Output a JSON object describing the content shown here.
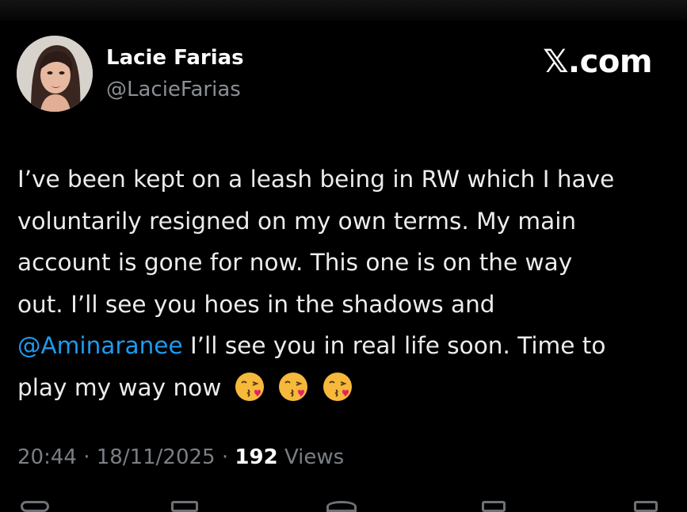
{
  "author": {
    "name": "Lacie Farias",
    "handle": "@LacieFarias",
    "avatar_icon": "profile-photo"
  },
  "brand": "𝕏.com",
  "tweet": {
    "lines": [
      "I’ve been kept on a leash being in RW which I have",
      "voluntarily resigned on my own terms. My main",
      "account is gone for now. This one is on the way",
      "out. I’ll see you hoes in the shadows and"
    ],
    "mention": "@Aminaranee",
    "line5_rest": " I’ll see you in real life soon. Time to",
    "line6": "play my way now",
    "emojis": [
      "kissing-heart-emoji",
      "kissing-heart-emoji",
      "kissing-heart-emoji"
    ]
  },
  "meta": {
    "time": "20:44",
    "date": "18/11/2025",
    "views_count": "192",
    "views_label": "Views"
  },
  "colors": {
    "background": "#000000",
    "text": "#ececec",
    "secondary": "#8b8f94",
    "mention": "#1d9bf0"
  }
}
